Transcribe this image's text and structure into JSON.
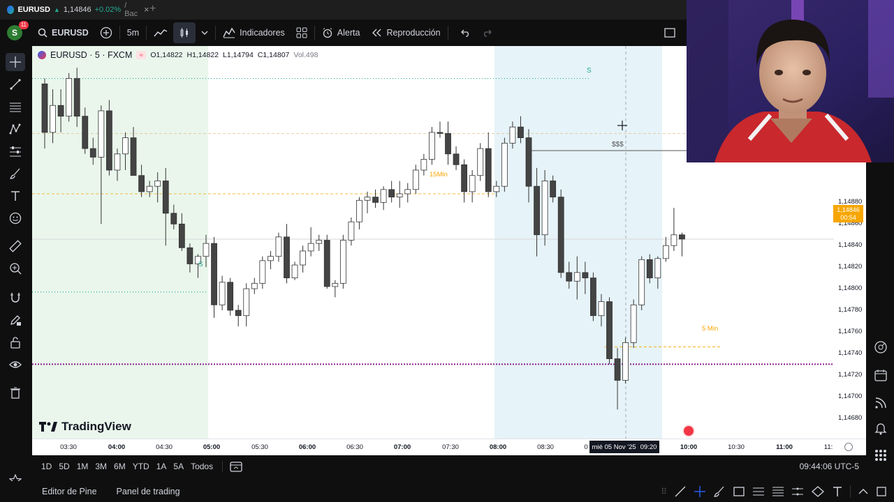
{
  "browser_tab": {
    "symbol": "EURUSD",
    "arrow": "▲",
    "price": "1,14846",
    "change": "+0.02%",
    "suffix": "/ Bac",
    "close": "×",
    "new_tab": "+"
  },
  "toolbar": {
    "avatar_letter": "S",
    "avatar_badge": "11",
    "symbol": "EURUSD",
    "interval": "5m",
    "indicators_label": "Indicadores",
    "alert_label": "Alerta",
    "replay_label": "Reproducción"
  },
  "legend": {
    "title": "EURUSD · 5 · FXCM",
    "open": "O1,14822",
    "high": "H1,14822",
    "low": "L1,14794",
    "close": "C1,14807",
    "volume": "Vol.498"
  },
  "annotations": {
    "liquidity_mark_top": "S",
    "liquidity_mark_left": "S",
    "triple_dollar": "$$$",
    "label_15min": "15Min",
    "label_5min": "5 Min"
  },
  "watermark": "TradingView",
  "current_price": {
    "price": "1,14846",
    "countdown": "00:54",
    "color": "#f7a600"
  },
  "price_axis": [
    "1,14880",
    "1,14860",
    "1,14840",
    "1,14820",
    "1,14800",
    "1,14780",
    "1,14760",
    "1,14740",
    "1,14720",
    "1,14700",
    "1,14680"
  ],
  "time_axis": [
    "03:30",
    "04:00",
    "04:30",
    "05:00",
    "05:30",
    "06:00",
    "06:30",
    "07:00",
    "07:30",
    "08:00",
    "08:30",
    "0",
    "10:00",
    "10:30",
    "11:00",
    "11:"
  ],
  "crosshair_time": {
    "date": "mié 05 Nov '25",
    "time": "09:20"
  },
  "ranges": [
    "1D",
    "5D",
    "1M",
    "3M",
    "6M",
    "YTD",
    "1A",
    "5A",
    "Todos"
  ],
  "clock": "09:44:06 UTC-5",
  "bottom_panels": {
    "pine_editor": "Editor de Pine",
    "trading_panel": "Panel de trading"
  },
  "colors": {
    "bull": "#ffffff",
    "bear": "#444444",
    "session_london": "#eaf6ec",
    "session_ny": "#e6f3f8",
    "liquidity_line": "#8a1f8a",
    "accent": "#f7a600",
    "up": "#22ab94"
  },
  "chart_data": {
    "type": "candlestick",
    "symbol": "EURUSD",
    "timeframe": "5",
    "x_times": [
      "03:15",
      "03:20",
      "03:25",
      "03:30",
      "03:35",
      "03:40",
      "03:45",
      "03:50",
      "03:55",
      "04:00",
      "04:05",
      "04:10",
      "04:15",
      "04:20",
      "04:25",
      "04:30",
      "04:35",
      "04:40",
      "04:45",
      "04:50",
      "04:55",
      "05:00",
      "05:05",
      "05:10",
      "05:15",
      "05:20",
      "05:25",
      "05:30",
      "05:35",
      "05:40",
      "05:45",
      "05:50",
      "05:55",
      "06:00",
      "06:05",
      "06:10",
      "06:15",
      "06:20",
      "06:25",
      "06:30",
      "06:35",
      "06:40",
      "06:45",
      "06:50",
      "06:55",
      "07:00",
      "07:05",
      "07:10",
      "07:15",
      "07:20",
      "07:25",
      "07:30",
      "07:35",
      "07:40",
      "07:45",
      "07:50",
      "07:55",
      "08:00",
      "08:05",
      "08:10",
      "08:15",
      "08:20",
      "08:25",
      "08:30",
      "08:35",
      "08:40",
      "08:45",
      "08:50",
      "08:55",
      "09:00",
      "09:05",
      "09:10",
      "09:15",
      "09:20",
      "09:25",
      "09:30",
      "09:35",
      "09:40"
    ],
    "candles": [
      [
        1.1499,
        1.14995,
        1.1493,
        1.14945
      ],
      [
        1.14945,
        1.14985,
        1.14935,
        1.1497
      ],
      [
        1.1497,
        1.14985,
        1.14945,
        1.1496
      ],
      [
        1.1496,
        1.15,
        1.14955,
        1.14995
      ],
      [
        1.14995,
        1.15005,
        1.1495,
        1.1496
      ],
      [
        1.1496,
        1.14968,
        1.14925,
        1.1493
      ],
      [
        1.1493,
        1.1494,
        1.14915,
        1.14922
      ],
      [
        1.14922,
        1.1497,
        1.1486,
        1.14965
      ],
      [
        1.14965,
        1.14975,
        1.14905,
        1.1491
      ],
      [
        1.1491,
        1.1493,
        1.149,
        1.14925
      ],
      [
        1.14925,
        1.14945,
        1.1491,
        1.1494
      ],
      [
        1.1494,
        1.1495,
        1.14905,
        1.14905
      ],
      [
        1.14905,
        1.14915,
        1.14885,
        1.1489
      ],
      [
        1.1489,
        1.149,
        1.14885,
        1.14895
      ],
      [
        1.14895,
        1.14908,
        1.1488,
        1.149
      ],
      [
        1.149,
        1.14912,
        1.1484,
        1.1487
      ],
      [
        1.1487,
        1.14878,
        1.14855,
        1.1486
      ],
      [
        1.1486,
        1.1487,
        1.14835,
        1.14838
      ],
      [
        1.14838,
        1.14842,
        1.14815,
        1.14823
      ],
      [
        1.14823,
        1.14832,
        1.1481,
        1.1483
      ],
      [
        1.1483,
        1.1485,
        1.1482,
        1.14842
      ],
      [
        1.14842,
        1.14848,
        1.14773,
        1.14785
      ],
      [
        1.14785,
        1.14812,
        1.1478,
        1.14806
      ],
      [
        1.14806,
        1.1481,
        1.14775,
        1.1478
      ],
      [
        1.1478,
        1.14785,
        1.14765,
        1.14775
      ],
      [
        1.14775,
        1.14805,
        1.14765,
        1.148
      ],
      [
        1.148,
        1.1481,
        1.14795,
        1.14805
      ],
      [
        1.14805,
        1.1483,
        1.148,
        1.14826
      ],
      [
        1.14826,
        1.14835,
        1.14818,
        1.1483
      ],
      [
        1.1483,
        1.14852,
        1.14825,
        1.14848
      ],
      [
        1.14848,
        1.1486,
        1.14805,
        1.1481
      ],
      [
        1.1481,
        1.14825,
        1.14808,
        1.14822
      ],
      [
        1.14822,
        1.1484,
        1.14815,
        1.14835
      ],
      [
        1.14835,
        1.14857,
        1.1483,
        1.14842
      ],
      [
        1.14842,
        1.1485,
        1.14835,
        1.14845
      ],
      [
        1.14845,
        1.1485,
        1.148,
        1.14802
      ],
      [
        1.14802,
        1.14808,
        1.14792,
        1.14805
      ],
      [
        1.14805,
        1.1485,
        1.148,
        1.14845
      ],
      [
        1.14845,
        1.14866,
        1.1484,
        1.14862
      ],
      [
        1.14862,
        1.14885,
        1.14855,
        1.14882
      ],
      [
        1.14882,
        1.1489,
        1.1487,
        1.14885
      ],
      [
        1.14885,
        1.14892,
        1.14875,
        1.1488
      ],
      [
        1.1488,
        1.14895,
        1.14873,
        1.14892
      ],
      [
        1.14892,
        1.149,
        1.1488,
        1.14885
      ],
      [
        1.14885,
        1.149,
        1.14875,
        1.14888
      ],
      [
        1.14888,
        1.14898,
        1.1488,
        1.14892
      ],
      [
        1.14892,
        1.14915,
        1.14888,
        1.1491
      ],
      [
        1.1491,
        1.14925,
        1.14905,
        1.1492
      ],
      [
        1.1492,
        1.1495,
        1.14915,
        1.14945
      ],
      [
        1.14945,
        1.14955,
        1.1494,
        1.14944
      ],
      [
        1.14944,
        1.14955,
        1.14915,
        1.14925
      ],
      [
        1.14925,
        1.14932,
        1.1491,
        1.14915
      ],
      [
        1.14915,
        1.1492,
        1.1488,
        1.1489
      ],
      [
        1.1489,
        1.1491,
        1.1488,
        1.14905
      ],
      [
        1.14905,
        1.14935,
        1.149,
        1.1493
      ],
      [
        1.1493,
        1.14945,
        1.14885,
        1.1489
      ],
      [
        1.1489,
        1.149,
        1.14885,
        1.14895
      ],
      [
        1.14895,
        1.1494,
        1.1489,
        1.14935
      ],
      [
        1.14935,
        1.14955,
        1.1493,
        1.1495
      ],
      [
        1.1495,
        1.1496,
        1.14935,
        1.1494
      ],
      [
        1.1494,
        1.14948,
        1.1488,
        1.14895
      ],
      [
        1.14895,
        1.14912,
        1.1483,
        1.1485
      ],
      [
        1.1485,
        1.1491,
        1.1484,
        1.149
      ],
      [
        1.149,
        1.14905,
        1.1488,
        1.14885
      ],
      [
        1.14885,
        1.14892,
        1.1481,
        1.14815
      ],
      [
        1.14815,
        1.14825,
        1.148,
        1.14807
      ],
      [
        1.14807,
        1.1483,
        1.1479,
        1.14815
      ],
      [
        1.14815,
        1.14825,
        1.14795,
        1.1481
      ],
      [
        1.1481,
        1.14815,
        1.1477,
        1.14775
      ],
      [
        1.14775,
        1.14795,
        1.14765,
        1.14788
      ],
      [
        1.14788,
        1.14792,
        1.1473,
        1.14735
      ],
      [
        1.14735,
        1.14745,
        1.14688,
        1.14715
      ],
      [
        1.14715,
        1.14755,
        1.14712,
        1.1475
      ],
      [
        1.1475,
        1.1479,
        1.14745,
        1.14785
      ],
      [
        1.14785,
        1.1483,
        1.1478,
        1.14827
      ],
      [
        1.14827,
        1.14832,
        1.14805,
        1.1481
      ],
      [
        1.1481,
        1.1483,
        1.148,
        1.14828
      ],
      [
        1.14828,
        1.14848,
        1.14825,
        1.1484
      ],
      [
        1.1484,
        1.14875,
        1.14835,
        1.1485
      ],
      [
        1.1485,
        1.14852,
        1.1483,
        1.14846
      ]
    ],
    "levels": {
      "top_liquidity": 1.14995,
      "mid_dashed": 1.14944,
      "line_15min": 1.14888,
      "line_5min": 1.14746,
      "purple_liquidity": 1.1473,
      "left_liquidity": 1.14797,
      "current": 1.14846,
      "crosshair": 1.14942
    },
    "ylim": [
      1.14672,
      1.14996
    ]
  }
}
